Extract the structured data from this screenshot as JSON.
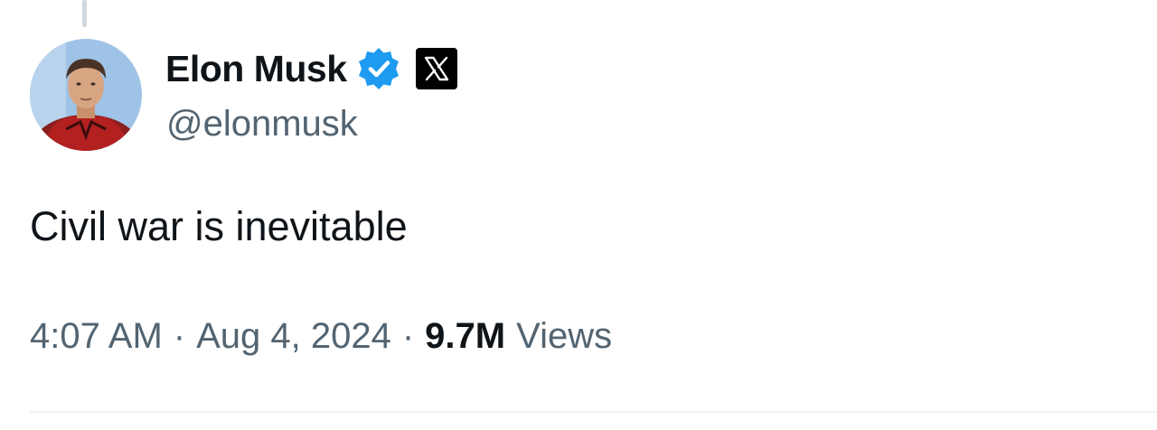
{
  "tweet": {
    "author": {
      "display_name": "Elon Musk",
      "handle": "@elonmusk",
      "verified": true,
      "badge_icon": "verified-badge-icon",
      "affiliation_icon": "x-logo-icon",
      "avatar": "profile-photo"
    },
    "text": "Civil war is inevitable",
    "time": "4:07 AM",
    "separator": "·",
    "date": "Aug 4, 2024",
    "views_count": "9.7M",
    "views_label": "Views"
  },
  "colors": {
    "text_primary": "#0f1419",
    "text_secondary": "#536471",
    "verified_blue": "#1d9bf0",
    "thread_line": "#cfd9de",
    "divider": "#eff3f4"
  }
}
